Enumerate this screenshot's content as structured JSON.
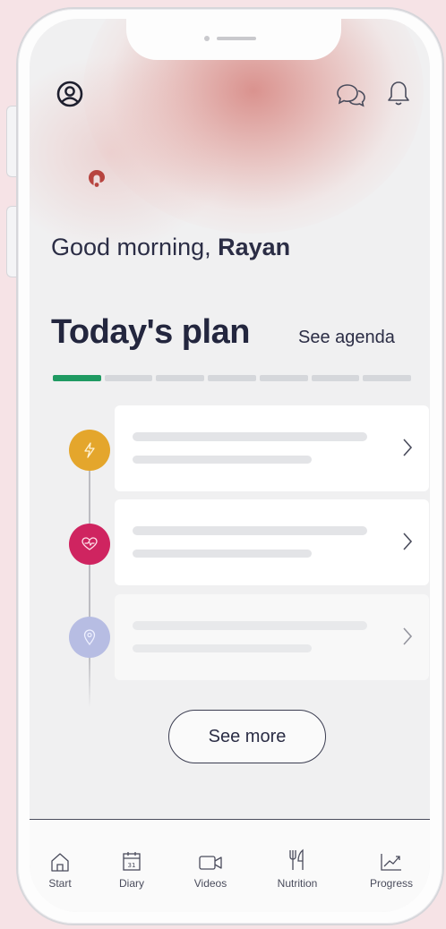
{
  "header": {
    "profile_icon": "user-circle-icon",
    "chat_icon": "chat-bubbles-icon",
    "bell_icon": "bell-icon",
    "logo_icon": "brand-logo-icon"
  },
  "greeting": {
    "text": "Good morning,",
    "name": "Rayan"
  },
  "plan": {
    "title": "Today's plan",
    "link": "See agenda",
    "progress_completed": 1,
    "progress_total": 7,
    "items": [
      {
        "icon": "lightning-icon",
        "color": "#e4a62c"
      },
      {
        "icon": "heart-pulse-icon",
        "color": "#cf2460"
      },
      {
        "icon": "location-pin-icon",
        "color": "#b7bde3"
      }
    ],
    "see_more": "See more"
  },
  "colors": {
    "accent_green": "#1f9a62",
    "text_dark": "#23263e"
  },
  "tabs": [
    {
      "label": "Start",
      "icon": "home-icon"
    },
    {
      "label": "Diary",
      "icon": "calendar-icon",
      "icon_text": "31"
    },
    {
      "label": "Videos",
      "icon": "video-camera-icon"
    },
    {
      "label": "Nutrition",
      "icon": "fork-knife-icon"
    },
    {
      "label": "Progress",
      "icon": "trend-chart-icon"
    }
  ]
}
